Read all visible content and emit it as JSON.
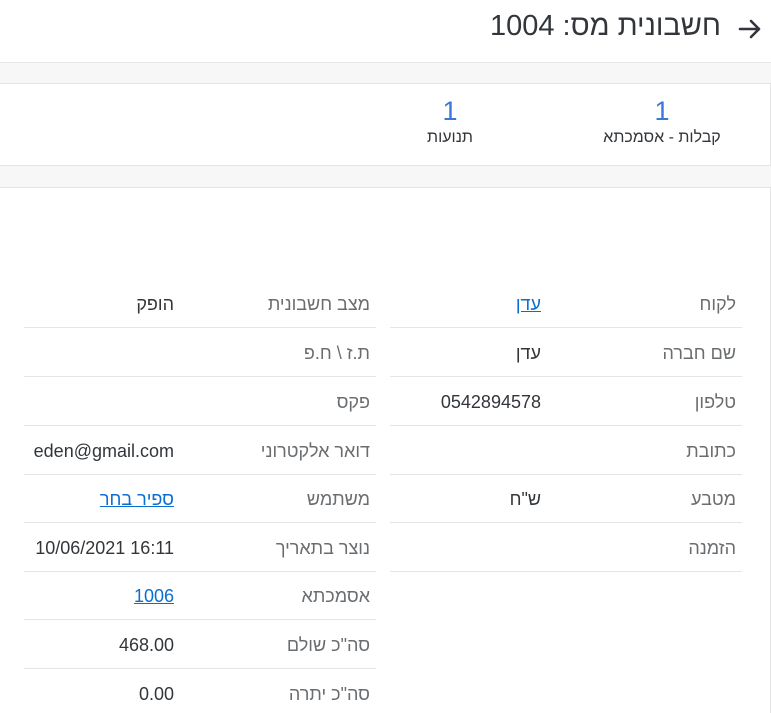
{
  "header": {
    "title": "חשבונית מס:  1004"
  },
  "tiles": [
    {
      "value": "1",
      "label": "קבלות - אסמכתא"
    },
    {
      "value": "1",
      "label": "תנועות"
    }
  ],
  "right_fields": [
    {
      "label": "לקוח",
      "value": "עדן",
      "link": true
    },
    {
      "label": "שם חברה",
      "value": "עדן",
      "link": false
    },
    {
      "label": "טלפון",
      "value": "0542894578",
      "link": false
    },
    {
      "label": "כתובת",
      "value": "",
      "link": false
    },
    {
      "label": "מטבע",
      "value": "ש\"ח",
      "link": false
    },
    {
      "label": "הזמנה",
      "value": "",
      "link": false
    }
  ],
  "left_fields": [
    {
      "label": "מצב חשבונית",
      "value": "הופק",
      "link": false
    },
    {
      "label": "ת.ז \\ ח.פ",
      "value": "",
      "link": false
    },
    {
      "label": "פקס",
      "value": "",
      "link": false
    },
    {
      "label": "דואר אלקטרוני",
      "value": "eden@gmail.com",
      "link": false
    },
    {
      "label": "משתמש",
      "value": "ספיר בחר",
      "link": true
    },
    {
      "label": "נוצר בתאריך",
      "value": "10/06/2021 16:11",
      "link": false
    },
    {
      "label": "אסמכתא",
      "value": "1006",
      "link": true
    },
    {
      "label": "סה\"כ שולם",
      "value": "468.00",
      "link": false
    },
    {
      "label": "סה\"כ יתרה",
      "value": "0.00",
      "link": false
    }
  ]
}
